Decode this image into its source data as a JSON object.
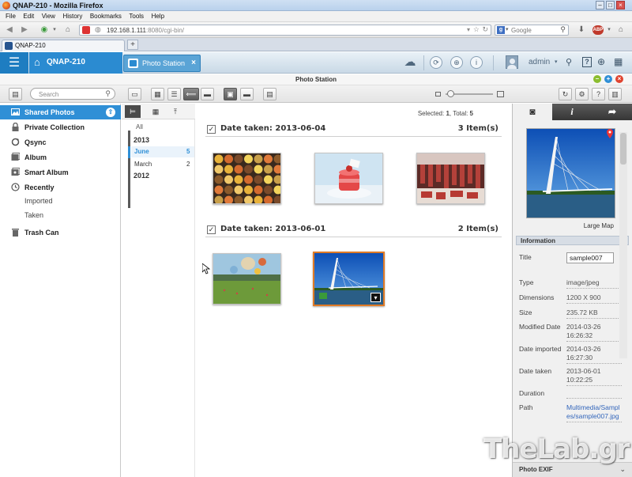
{
  "window": {
    "title": "QNAP-210 - Mozilla Firefox"
  },
  "menubar": [
    "File",
    "Edit",
    "View",
    "History",
    "Bookmarks",
    "Tools",
    "Help"
  ],
  "navbar": {
    "url_host": "192.168.1.111",
    "url_rest": ":8080/cgi-bin/",
    "search_placeholder": "Google"
  },
  "browser_tab": {
    "label": "QNAP-210",
    "new_tab": "+"
  },
  "qts": {
    "home_label": "QNAP-210",
    "app_tab_label": "Photo Station",
    "app_tab_close": "×",
    "user": "admin"
  },
  "app": {
    "title": "Photo Station"
  },
  "toolbar": {
    "search_placeholder": "Search"
  },
  "sidebar": {
    "items": [
      {
        "label": "Shared Photos",
        "icon": "photo-icon",
        "active": true
      },
      {
        "label": "Private Collection",
        "icon": "lock-icon"
      },
      {
        "label": "Qsync",
        "icon": "sync-icon"
      },
      {
        "label": "Album",
        "icon": "album-icon"
      },
      {
        "label": "Smart Album",
        "icon": "smart-album-icon"
      },
      {
        "label": "Recently",
        "icon": "clock-icon"
      },
      {
        "label": "Trash Can",
        "icon": "trash-icon"
      }
    ],
    "recently_sub": [
      "Imported",
      "Taken"
    ]
  },
  "timeline": {
    "all": "All",
    "years": [
      {
        "year": "2013",
        "months": [
          {
            "name": "June",
            "count": "5",
            "selected": true
          },
          {
            "name": "March",
            "count": "2"
          }
        ]
      },
      {
        "year": "2012",
        "months": []
      }
    ]
  },
  "main": {
    "selected_label": "Selected:",
    "selected": "1",
    "total_label": ", Total:",
    "total": "5",
    "groups": [
      {
        "label": "Date taken: 2013-06-04",
        "count": "3 Item(s)",
        "photos": [
          "macarons",
          "strawberry-cake",
          "meat-market"
        ]
      },
      {
        "label": "Date taken: 2013-06-01",
        "count": "2 Item(s)",
        "photos": [
          "hot-air-balloons",
          "sundial-bridge"
        ]
      }
    ]
  },
  "info_panel": {
    "map_label": "Large Map",
    "section": "Information",
    "title_label": "Title",
    "title_value": "sample007",
    "fields": [
      {
        "k": "Type",
        "v": "image/jpeg"
      },
      {
        "k": "Dimensions",
        "v": "1200 X 900"
      },
      {
        "k": "Size",
        "v": "235.72 KB"
      },
      {
        "k": "Modified Date",
        "v": "2014-03-26 16:26:32"
      },
      {
        "k": "Date imported",
        "v": "2014-03-26 16:27:30"
      },
      {
        "k": "Date taken",
        "v": "2013-06-01 10:22:25"
      },
      {
        "k": "Duration",
        "v": ""
      },
      {
        "k": "Path",
        "v": "Multimedia/Samples/sample007.jpg"
      }
    ],
    "exif": "Photo EXIF"
  },
  "watermark": "TheLab.gr",
  "colors": {
    "accent": "#2f8fd6",
    "selection": "#e07a25",
    "qts_blue": "#1e7dc1"
  }
}
